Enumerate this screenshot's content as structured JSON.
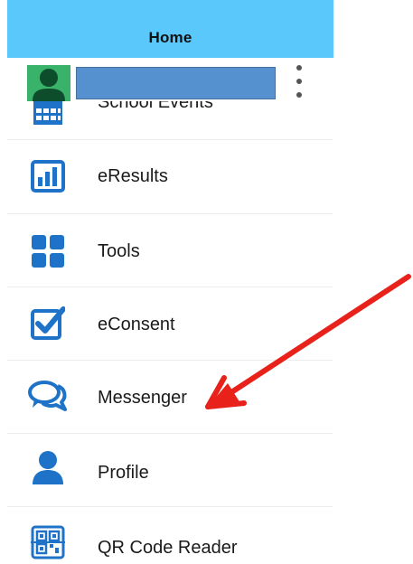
{
  "header": {
    "title": "Home"
  },
  "profile": {
    "name_redacted": true,
    "more_icon": "kebab-icon"
  },
  "menu": {
    "items": [
      {
        "label": "School Events",
        "icon": "calendar-icon"
      },
      {
        "label": "eResults",
        "icon": "chart-icon"
      },
      {
        "label": "Tools",
        "icon": "grid-icon"
      },
      {
        "label": "eConsent",
        "icon": "checkbox-icon"
      },
      {
        "label": "Messenger",
        "icon": "chat-bubbles-icon"
      },
      {
        "label": "Profile",
        "icon": "person-icon"
      },
      {
        "label": "QR Code Reader",
        "icon": "qr-code-icon"
      }
    ]
  },
  "colors": {
    "accent": "#5bc8fb",
    "icon_blue": "#1e73c8",
    "avatar": "#39b36a",
    "arrow": "#e8221b"
  }
}
